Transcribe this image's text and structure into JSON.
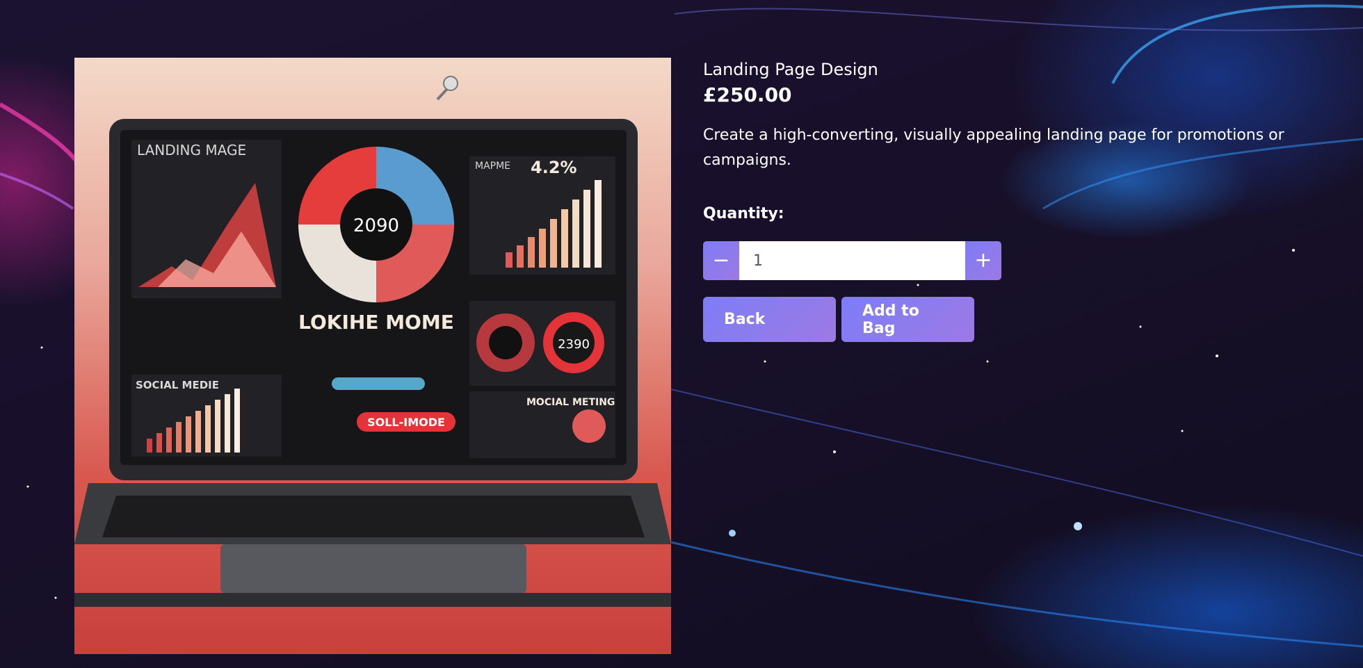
{
  "product": {
    "title": "Landing Page Design",
    "price": "£250.00",
    "description": "Create a high-converting, visually appealing landing page for promotions or campaigns.",
    "image_alt": "laptop showing landing page dashboard"
  },
  "quantity": {
    "label": "Quantity:",
    "value": "1",
    "decrement_symbol": "−",
    "increment_symbol": "+"
  },
  "actions": {
    "back_label": "Back",
    "add_label": "Add to Bag"
  },
  "image_screen": {
    "heading_left": "LANDING MAGE",
    "center_metric": "2090",
    "center_title": "LOKIHE MOME",
    "percent": "4.2%",
    "social": "SOCIAL MEDIE",
    "social_meting": "MOCIAL METING",
    "cta": "SOLL-IMODE",
    "small_metric": "2390",
    "marketing": "MAPME"
  },
  "colors": {
    "accent_start": "#7f7cf4",
    "accent_end": "#9b79e6",
    "image_red": "#d8584f"
  }
}
